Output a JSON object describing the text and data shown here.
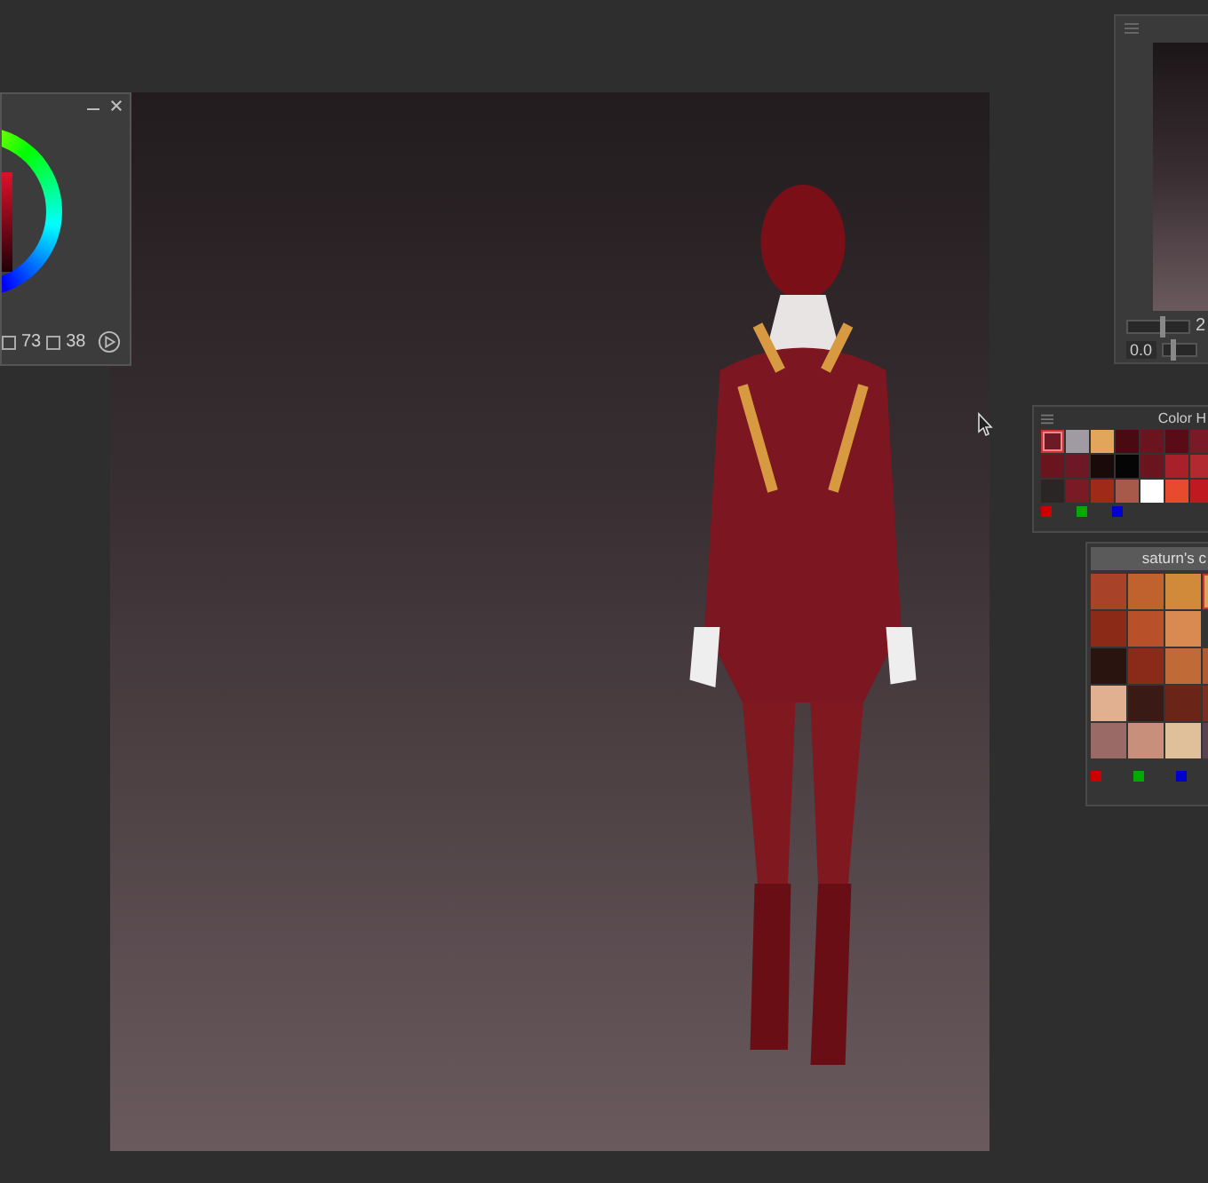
{
  "color_wheel_panel": {
    "saturation": "73",
    "value": "38"
  },
  "navigator_panel": {
    "zoom_slider": {
      "level": 0.55,
      "reading": "2"
    },
    "rotation_slider": {
      "level": 0.3,
      "value": "0.0"
    }
  },
  "color_history_panel": {
    "title": "Color H",
    "swatches": [
      {
        "color": "#6e1a26",
        "selected": true
      },
      {
        "color": "#a09aa3",
        "selected": false
      },
      {
        "color": "#e2a65a",
        "selected": false
      },
      {
        "color": "#4a0a12",
        "selected": false
      },
      {
        "color": "#6a1420",
        "selected": false
      },
      {
        "color": "#5a0c16",
        "selected": false
      },
      {
        "color": "#7a1a26",
        "selected": false
      },
      {
        "color": "#6a1420",
        "selected": false
      },
      {
        "color": "#6e1826",
        "selected": false
      },
      {
        "color": "#1a0a0a",
        "selected": false
      },
      {
        "color": "#050505",
        "selected": false
      },
      {
        "color": "#6a1420",
        "selected": false
      },
      {
        "color": "#a8202a",
        "selected": false
      },
      {
        "color": "#b02a30",
        "selected": false
      },
      {
        "color": "#2a2626",
        "selected": false
      },
      {
        "color": "#7a1a24",
        "selected": false
      },
      {
        "color": "#a02a18",
        "selected": false
      },
      {
        "color": "#a85a4a",
        "selected": false
      },
      {
        "color": "#ffffff",
        "selected": false
      },
      {
        "color": "#e84a30",
        "selected": false
      },
      {
        "color": "#c01a20",
        "selected": false
      }
    ]
  },
  "color_set_panel": {
    "title": "saturn's c",
    "swatches": [
      {
        "color": "#a8432a",
        "selected": false
      },
      {
        "color": "#c0622e",
        "selected": false
      },
      {
        "color": "#d08a3a",
        "selected": false
      },
      {
        "color": "#e0a060",
        "selected": true
      },
      {
        "color": "#8c2a18",
        "selected": false
      },
      {
        "color": "#b8502a",
        "selected": false
      },
      {
        "color": "#d88a50",
        "selected": false
      },
      {
        "color": "#333333",
        "selected": false
      },
      {
        "color": "#2a1410",
        "selected": false
      },
      {
        "color": "#8a2a18",
        "selected": false
      },
      {
        "color": "#c06a38",
        "selected": false
      },
      {
        "color": "#b05a30",
        "selected": false
      },
      {
        "color": "#e0b090",
        "selected": false
      },
      {
        "color": "#3a1a14",
        "selected": false
      },
      {
        "color": "#6a2418",
        "selected": false
      },
      {
        "color": "#7a3020",
        "selected": false
      },
      {
        "color": "#9a6a66",
        "selected": false
      },
      {
        "color": "#c8907a",
        "selected": false
      },
      {
        "color": "#e0c09a",
        "selected": false
      },
      {
        "color": "#5a4050",
        "selected": false
      }
    ]
  }
}
